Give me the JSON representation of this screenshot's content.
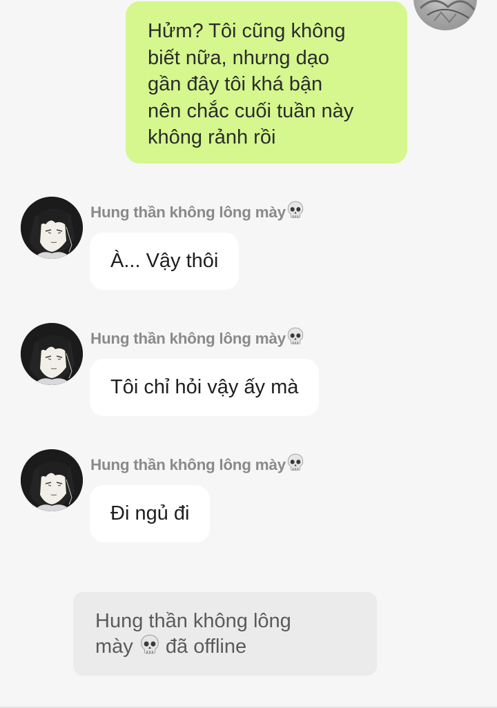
{
  "chat": {
    "sent_message": {
      "text": "Hửm? Tôi cũng không\nbiết nữa, nhưng dạo\ngần đây tôi khá bận\nnên chắc cuối tuần này\nkhông rảnh rồi"
    },
    "received_messages": [
      {
        "sender": "Hung thần không lông mày",
        "text": "À... Vậy thôi"
      },
      {
        "sender": "Hung thần không lông mày",
        "text": "Tôi chỉ hỏi vậy ấy mà"
      },
      {
        "sender": "Hung thần không lông mày",
        "text": "Đi ngủ đi"
      }
    ],
    "system_notice": {
      "line1": "Hung thần không lông",
      "line2_before": "mày",
      "line2_after": "đã offline"
    }
  },
  "icons": {
    "sender_emoji": "skull-icon",
    "notice_emoji": "skull-icon"
  },
  "colors": {
    "sent_bubble": "#d5f78e",
    "received_bubble": "#ffffff",
    "background": "#f6f6f6",
    "sender_name": "#8a8a8a",
    "notice_bubble": "#ebebeb"
  }
}
